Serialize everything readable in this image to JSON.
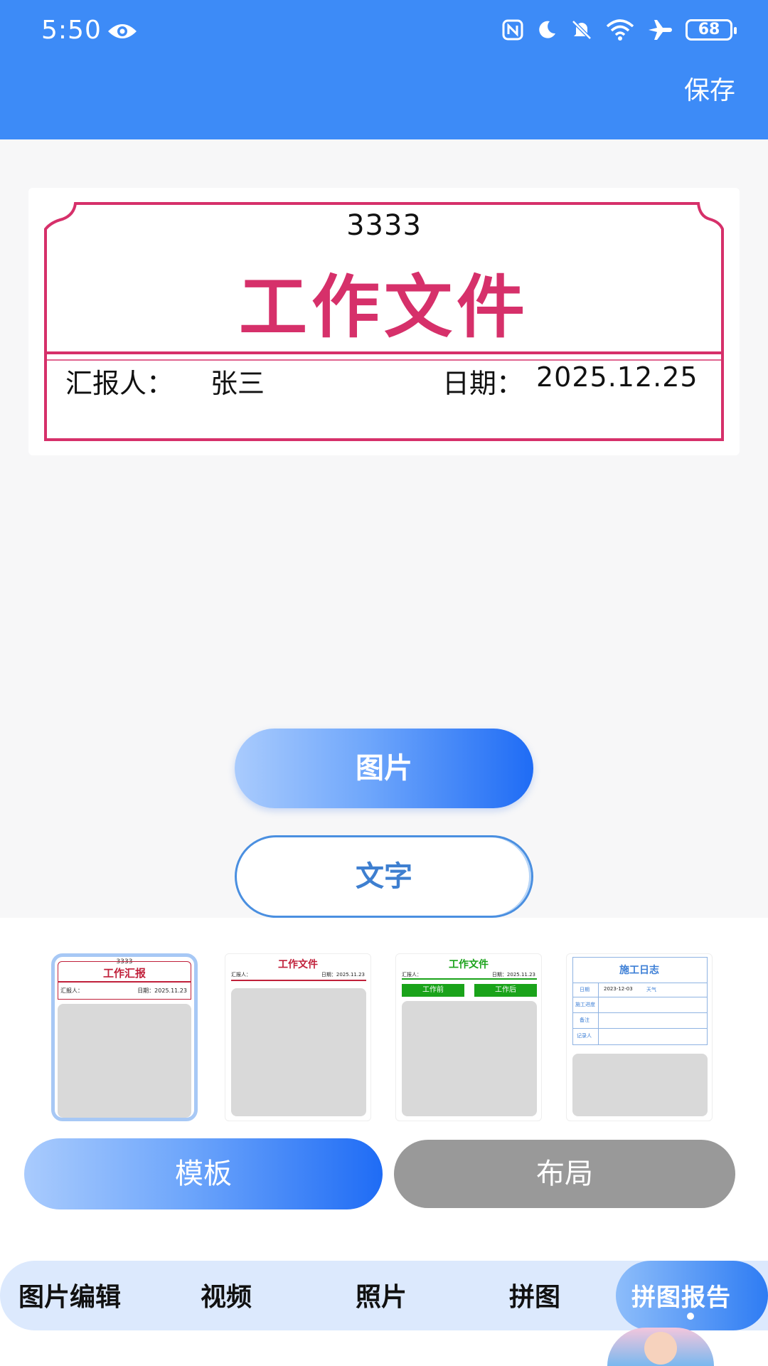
{
  "status_bar": {
    "time": "5:50",
    "battery": "68"
  },
  "header": {
    "save_label": "保存"
  },
  "report": {
    "number": "3333",
    "title": "工作文件",
    "reporter_label": "汇报人：",
    "reporter_name": "张三",
    "date_label": "日期：",
    "date_value": "2025.12.25",
    "accent_color": "#d6306a"
  },
  "actions": {
    "image_label": "图片",
    "text_label": "文字"
  },
  "templates": [
    {
      "number": "3333",
      "title": "工作汇报",
      "reporter_label": "汇报人：",
      "date_text": "日期：2025.11.23",
      "color": "#c0203a"
    },
    {
      "title": "工作文件",
      "reporter_label": "汇报人：",
      "date_text": "日期：2025.11.23",
      "color": "#c0203a"
    },
    {
      "title": "工作文件",
      "reporter_label": "汇报人：",
      "date_text": "日期：2025.11.23",
      "before_label": "工作前",
      "after_label": "工作后",
      "color": "#1aa31a"
    },
    {
      "title": "施工日志",
      "date_label": "日期",
      "date_value": "2023-12-03",
      "weather_label": "天气",
      "progress_label": "施工进度",
      "note_label": "备注",
      "recorder_label": "记录人",
      "color": "#3d7fd6"
    }
  ],
  "tabs": {
    "template_label": "模板",
    "layout_label": "布局"
  },
  "bottom_nav": {
    "items": [
      "图片编辑",
      "视频",
      "照片",
      "拼图"
    ],
    "active": "拼图报告"
  },
  "colors": {
    "brand_blue": "#3d8bf7",
    "nav_bg": "#dce9fd",
    "inactive_gray": "#999999"
  }
}
